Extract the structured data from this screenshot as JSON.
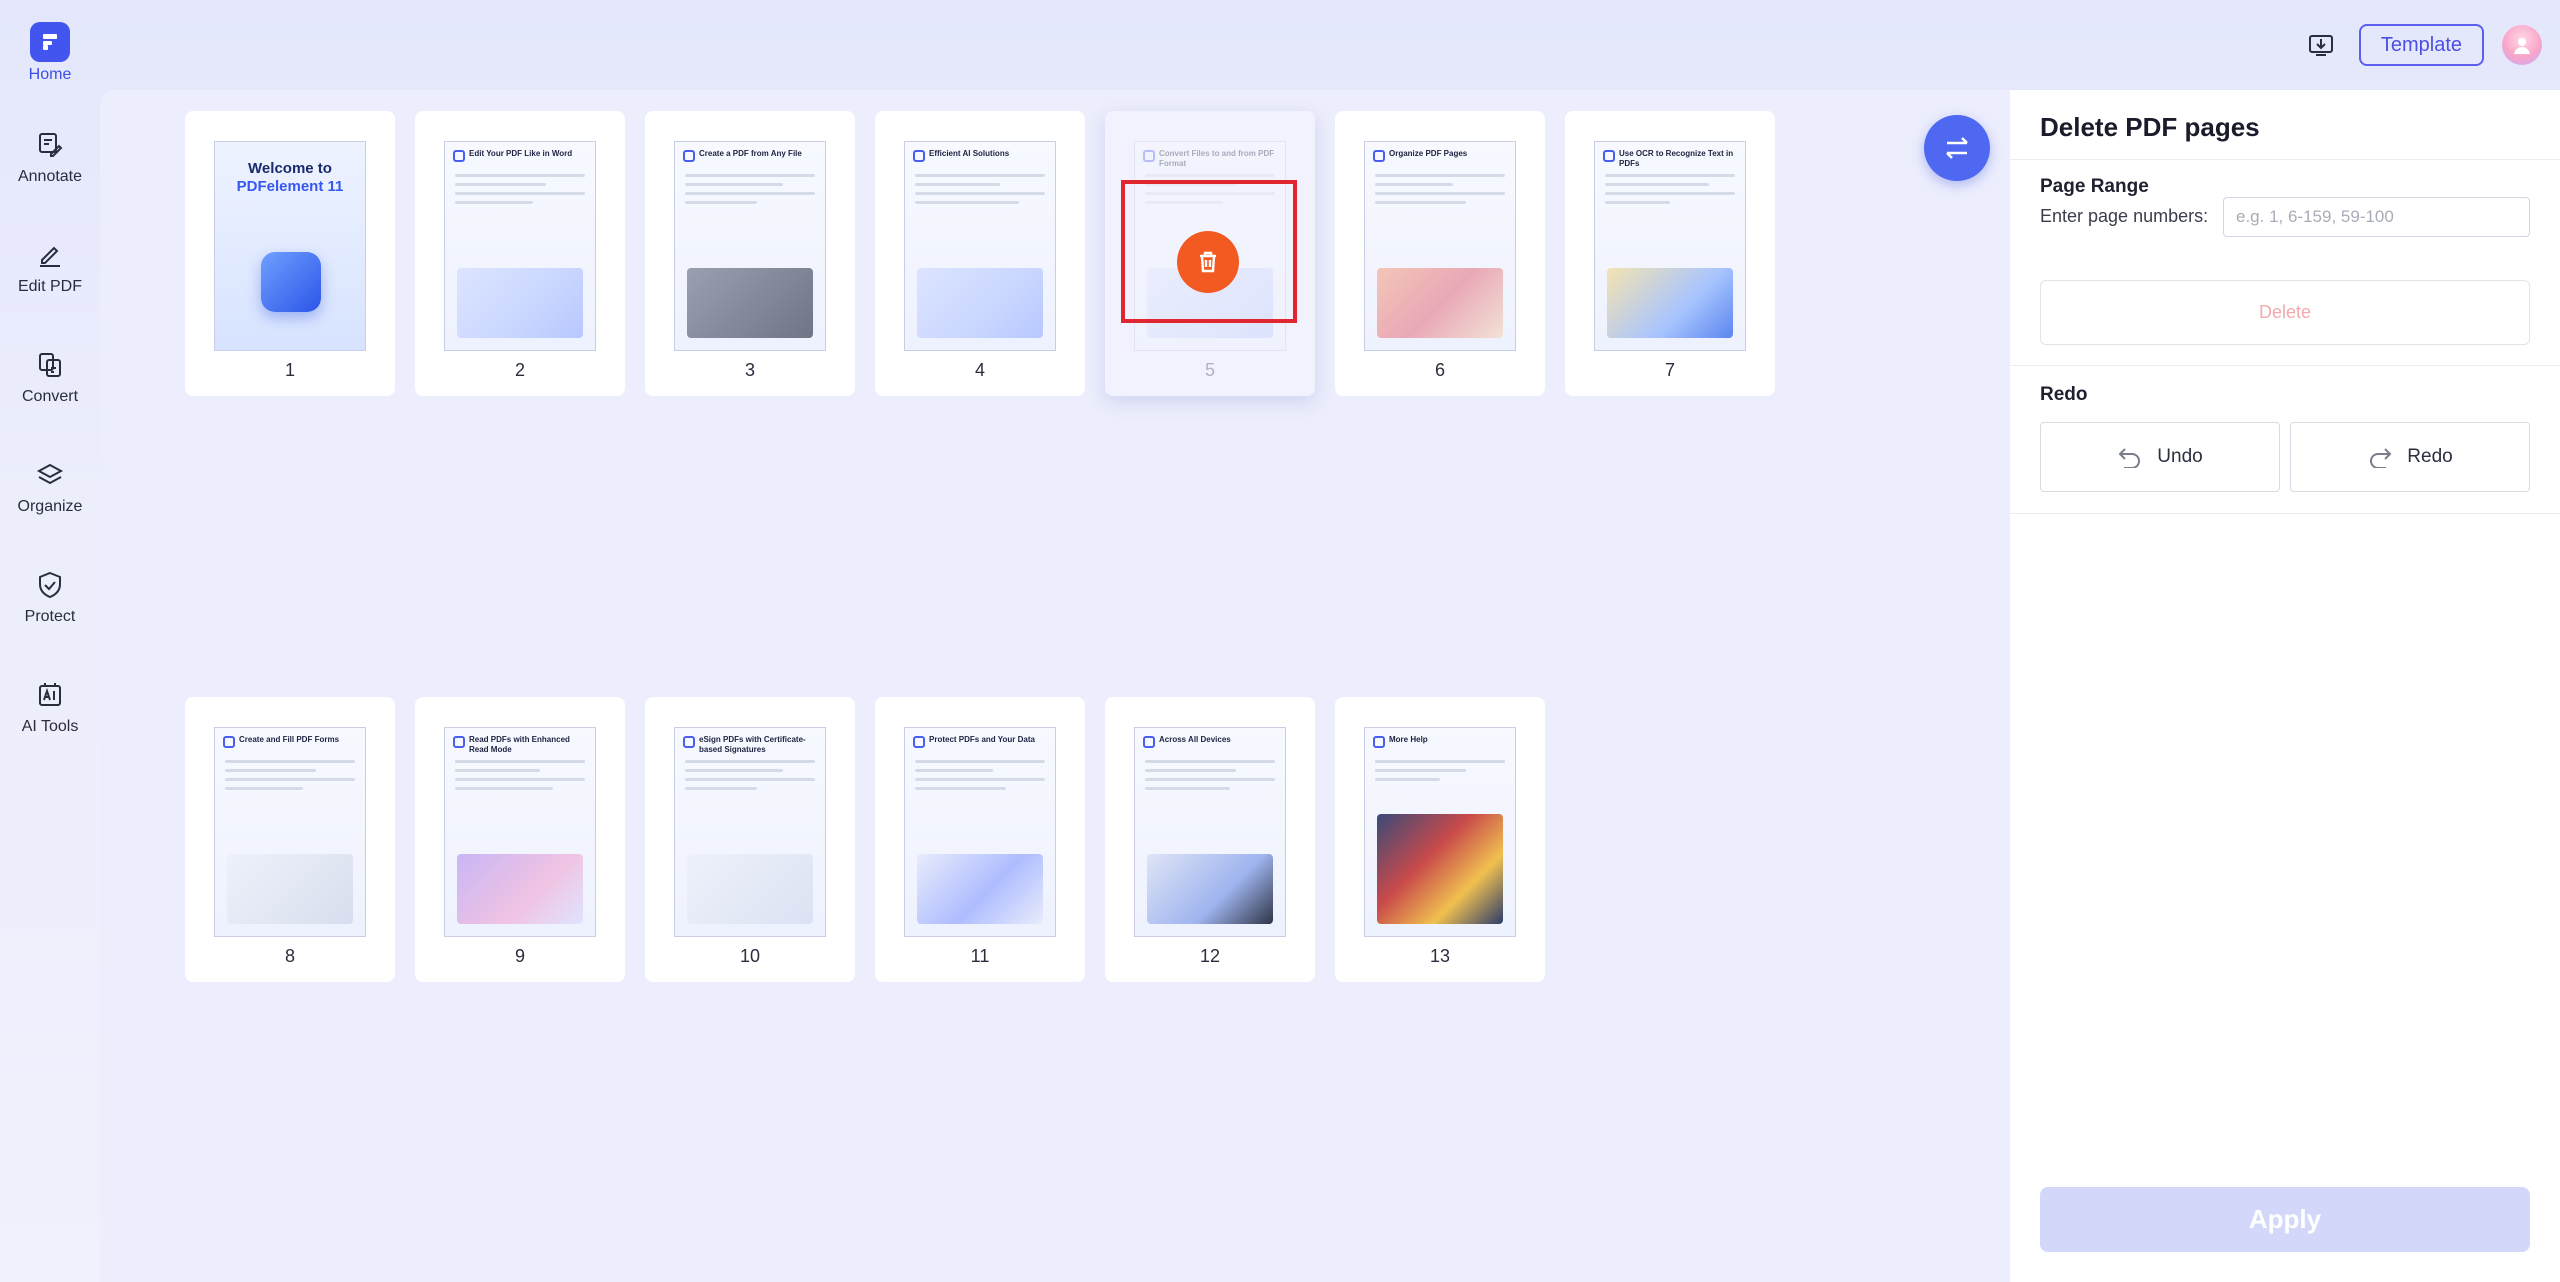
{
  "nav": {
    "items": [
      {
        "label": "Home",
        "icon": "home-icon"
      },
      {
        "label": "Annotate",
        "icon": "annotate-icon"
      },
      {
        "label": "Edit PDF",
        "icon": "edit-pdf-icon"
      },
      {
        "label": "Convert",
        "icon": "convert-icon"
      },
      {
        "label": "Organize",
        "icon": "organize-icon"
      },
      {
        "label": "Protect",
        "icon": "protect-icon"
      },
      {
        "label": "AI Tools",
        "icon": "ai-tools-icon"
      }
    ],
    "active": "Home"
  },
  "topbar": {
    "template_label": "Template"
  },
  "pages": [
    {
      "number": "1",
      "title": "Welcome to PDFelement 11"
    },
    {
      "number": "2",
      "title": "Edit Your PDF Like in Word"
    },
    {
      "number": "3",
      "title": "Create a PDF from Any File"
    },
    {
      "number": "4",
      "title": "Efficient AI Solutions"
    },
    {
      "number": "5",
      "title": "Convert Files to and from PDF Format"
    },
    {
      "number": "6",
      "title": "Organize PDF Pages"
    },
    {
      "number": "7",
      "title": "Use OCR to Recognize Text in PDFs"
    },
    {
      "number": "8",
      "title": "Create and Fill PDF Forms"
    },
    {
      "number": "9",
      "title": "Read PDFs with Enhanced Read Mode"
    },
    {
      "number": "10",
      "title": "eSign PDFs with Certificate-based Signatures"
    },
    {
      "number": "11",
      "title": "Protect PDFs and Your Data"
    },
    {
      "number": "12",
      "title": "Across All Devices"
    },
    {
      "number": "13",
      "title": "More Help"
    }
  ],
  "selected_page": "5",
  "panel": {
    "title": "Delete PDF pages",
    "page_range_label": "Page Range",
    "enter_label": "Enter page numbers:",
    "input_placeholder": "e.g. 1, 6-159, 59-100",
    "input_value": "",
    "delete_label": "Delete",
    "redo_section_label": "Redo",
    "undo_label": "Undo",
    "redo_label": "Redo",
    "apply_label": "Apply"
  },
  "colors": {
    "accent": "#4f68f2",
    "trash": "#f25a22",
    "selection_border": "#e0262e",
    "apply_disabled": "#d3d8fb"
  }
}
